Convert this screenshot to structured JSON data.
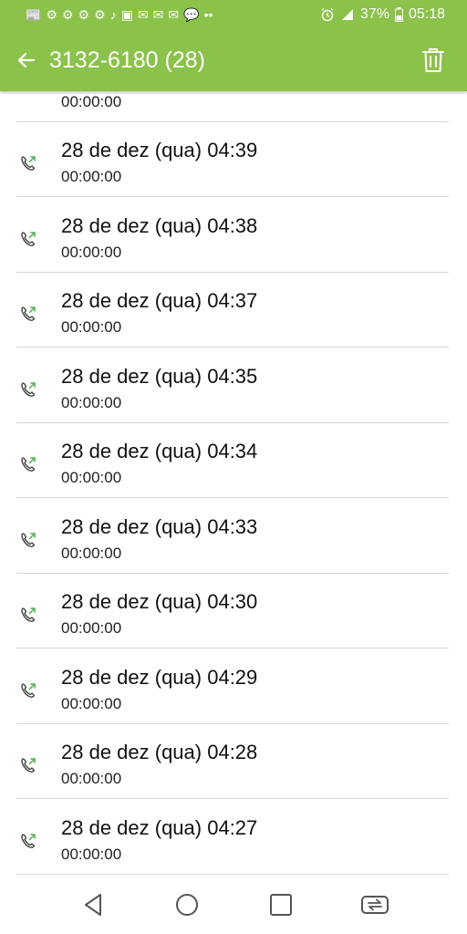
{
  "status_bar": {
    "notification_icons": [
      "📰",
      "⚙",
      "⚙",
      "⚙",
      "⚙",
      "♪",
      "▣",
      "✉",
      "✉",
      "✉",
      "💬",
      "••"
    ],
    "battery": "37%",
    "time": "05:18"
  },
  "app_bar": {
    "title": "3132-6180 (28)"
  },
  "calls": {
    "partial_top_duration": "00:00:00",
    "items": [
      {
        "date": "28 de dez (qua) 04:39",
        "duration": "00:00:00"
      },
      {
        "date": "28 de dez (qua) 04:38",
        "duration": "00:00:00"
      },
      {
        "date": "28 de dez (qua) 04:37",
        "duration": "00:00:00"
      },
      {
        "date": "28 de dez (qua) 04:35",
        "duration": "00:00:00"
      },
      {
        "date": "28 de dez (qua) 04:34",
        "duration": "00:00:00"
      },
      {
        "date": "28 de dez (qua) 04:33",
        "duration": "00:00:00"
      },
      {
        "date": "28 de dez (qua) 04:30",
        "duration": "00:00:00"
      },
      {
        "date": "28 de dez (qua) 04:29",
        "duration": "00:00:00"
      },
      {
        "date": "28 de dez (qua) 04:28",
        "duration": "00:00:00"
      },
      {
        "date": "28 de dez (qua) 04:27",
        "duration": "00:00:00"
      }
    ]
  },
  "colors": {
    "accent": "#8bc34a",
    "call_icon": "#4caf50"
  }
}
